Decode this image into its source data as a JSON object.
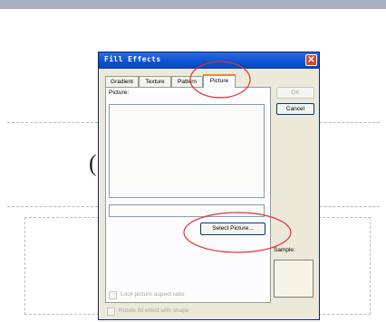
{
  "dialog": {
    "title": "Fill Effects",
    "close_glyph": "✕",
    "tabs": [
      {
        "label": "Gradient"
      },
      {
        "label": "Texture"
      },
      {
        "label": "Pattern"
      },
      {
        "label": "Picture"
      }
    ],
    "active_tab": "Picture",
    "picture_label": "Picture:",
    "select_button": "Select Picture...",
    "lock_checkbox": {
      "label": "Lock picture aspect ratio",
      "checked": false,
      "enabled": false
    },
    "rotate_checkbox": {
      "label": "Rotate fill effect with shape",
      "checked": false,
      "enabled": false
    },
    "ok_button": "OK",
    "cancel_button": "Cancel",
    "sample_label": "Sample:"
  },
  "background": {
    "glyph": "("
  },
  "colors": {
    "annotation": "#e0313a",
    "titlebar": "#0a50d0",
    "dialog_bg": "#ece9d8"
  }
}
